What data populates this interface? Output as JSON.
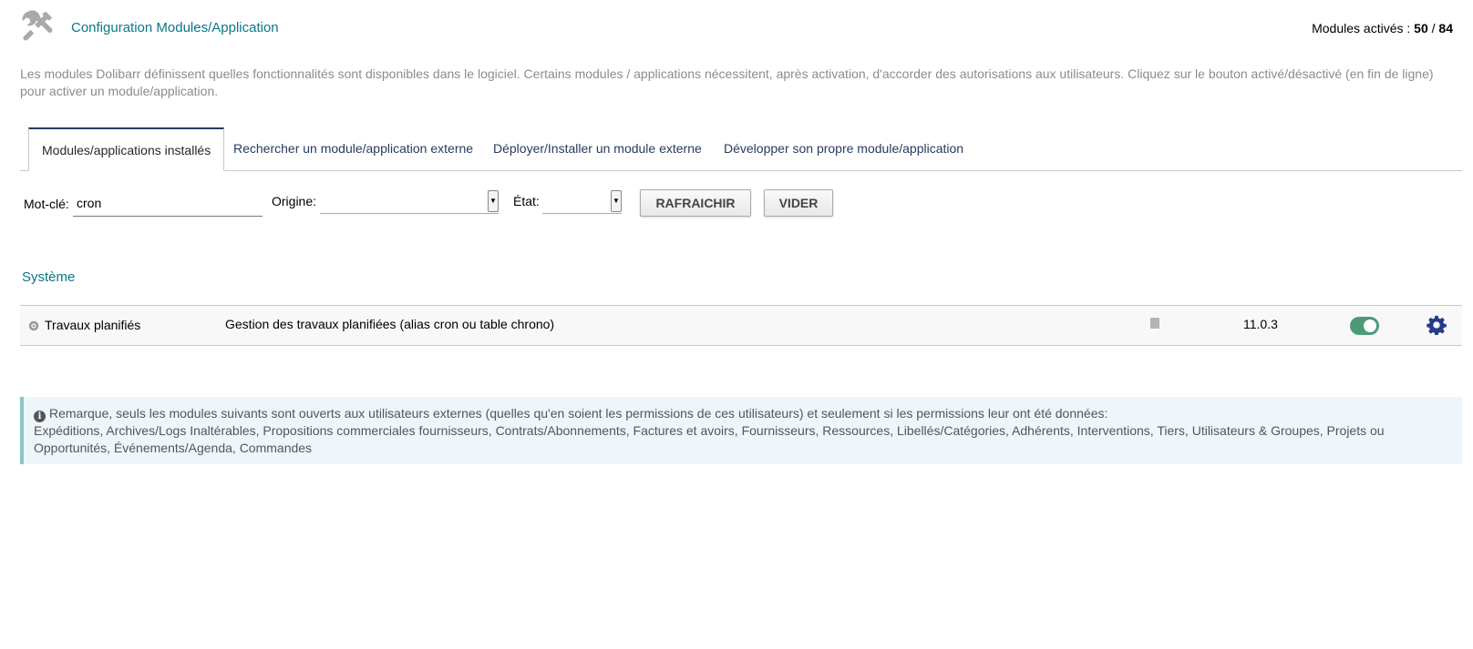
{
  "header": {
    "title": "Configuration Modules/Application",
    "modules_label": "Modules activés : ",
    "modules_active": "50",
    "modules_sep": " / ",
    "modules_total": "84",
    "icon": "tools-icon"
  },
  "description": "Les modules Dolibarr définissent quelles fonctionnalités sont disponibles dans le logiciel. Certains modules / applications nécessitent, après activation, d'accorder des autorisations aux utilisateurs. Cliquez sur le bouton activé/désactivé (en fin de ligne) pour activer un module/application.",
  "tabs": [
    {
      "label": "Modules/applications installés",
      "active": true
    },
    {
      "label": "Rechercher un module/application externe",
      "active": false
    },
    {
      "label": "Déployer/Installer un module externe",
      "active": false
    },
    {
      "label": "Développer son propre module/application",
      "active": false
    }
  ],
  "filters": {
    "keyword_label": "Mot-clé:",
    "keyword_value": "cron",
    "origin_label": "Origine:",
    "origin_value": "",
    "state_label": "État:",
    "state_value": "",
    "refresh_label": "RAFRAICHIR",
    "clear_label": "VIDER"
  },
  "section": {
    "title": "Système"
  },
  "modules": [
    {
      "name": "Travaux planifiés",
      "description": "Gestion des travaux planifiées (alias cron ou table chrono)",
      "version": "11.0.3",
      "enabled": true,
      "icon": "cron-gear-icon"
    }
  ],
  "note": {
    "line1": "Remarque, seuls les modules suivants sont ouverts aux utilisateurs externes (quelles qu'en soient les permissions de ces utilisateurs) et seulement si les permissions leur ont été données:",
    "line2": "Expéditions, Archives/Logs Inaltérables, Propositions commerciales fournisseurs, Contrats/Abonnements, Factures et avoirs, Fournisseurs, Ressources, Libellés/Catégories, Adhérents, Interventions, Tiers, Utilisateurs & Groupes, Projets ou Opportunités, Événements/Agenda, Commandes"
  },
  "colors": {
    "accent": "#0a7788",
    "tab_link": "#263c5c",
    "toggle_on": "#4e9a78",
    "gear": "#263c8a"
  }
}
